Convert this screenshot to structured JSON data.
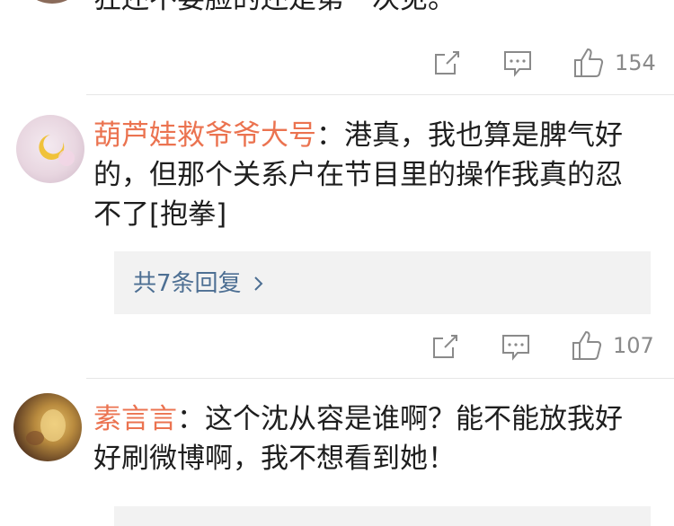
{
  "comment0": {
    "text_partial": "狂还不要脸的还是第一次见。",
    "likes": "154"
  },
  "comment1": {
    "username": "葫芦娃救爷爷大号",
    "separator": "：",
    "line1": "港真，我也算是脾气好",
    "line2": "的，但那个关系户在节目里的操作我真的忍",
    "line3": "不了[抱拳]",
    "replies_label": "共7条回复",
    "likes": "107"
  },
  "comment2": {
    "username": "素言言",
    "separator": "：",
    "line1": "这个沈从容是谁啊？能不能放我好",
    "line2": "好刷微博啊，我不想看到她！"
  },
  "icons": {
    "repost": "share-icon",
    "comment": "comment-icon",
    "like": "thumbs-up-icon",
    "chevron": "chevron-right-icon"
  },
  "colors": {
    "username": "#eb7350",
    "link": "#4d6f93",
    "meta": "#888888",
    "reply_bg": "#f2f2f2"
  }
}
